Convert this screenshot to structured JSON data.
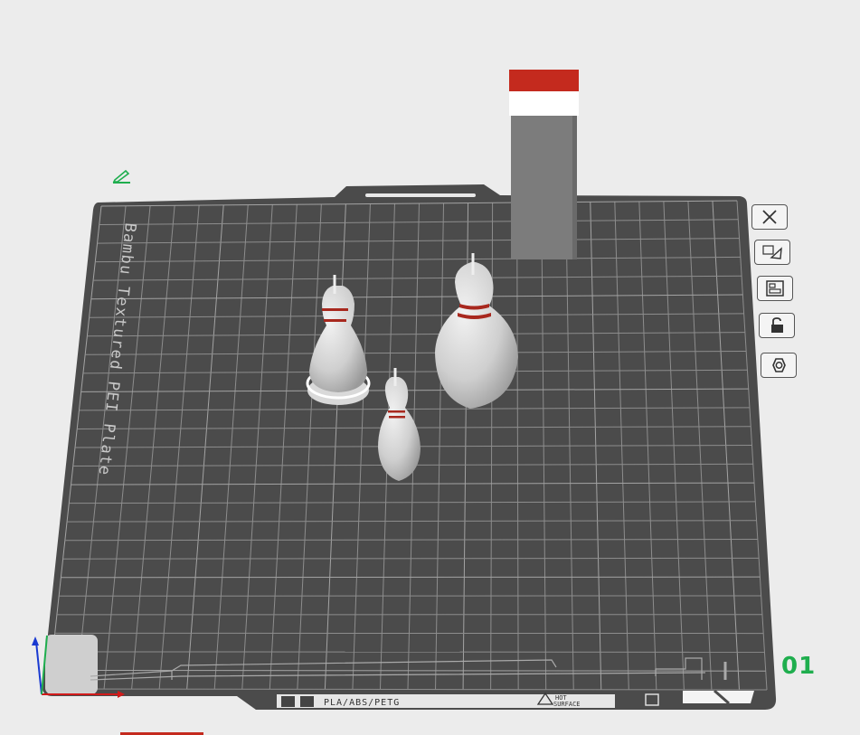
{
  "app": {
    "view": "3D Prepare view"
  },
  "plate": {
    "name_text": "Bambu Textured PEI Plate",
    "filament_types": "PLA/ABS/PETG",
    "surface_warning_line1": "HOT",
    "surface_warning_line2": "SURFACE",
    "plate_number": "01"
  },
  "side_toolbar": {
    "buttons": [
      {
        "name": "close-plate-button",
        "icon": "close-icon"
      },
      {
        "name": "auto-arrange-button",
        "icon": "arrange-icon"
      },
      {
        "name": "plate-layout-button",
        "icon": "layout-icon"
      },
      {
        "name": "lock-plate-button",
        "icon": "lock-icon"
      },
      {
        "name": "plate-settings-button",
        "icon": "gear-hex-icon"
      }
    ]
  },
  "objects": [
    {
      "name": "bowling-pin-1",
      "selected": true
    },
    {
      "name": "bowling-pin-2",
      "selected": false
    },
    {
      "name": "bowling-pin-3",
      "selected": false
    },
    {
      "name": "wipe-tower",
      "selected": false
    }
  ],
  "colors": {
    "plate": "#4d4d4d",
    "grid": "#8a8a8a",
    "selection": "#ffffff",
    "tower_red": "#c42a1e",
    "pin_stripe": "#a8281e",
    "plate_number": "#1fae4e",
    "axis_x": "#d11a1a",
    "axis_y": "#1fae4e",
    "axis_z": "#1a3ad1"
  }
}
